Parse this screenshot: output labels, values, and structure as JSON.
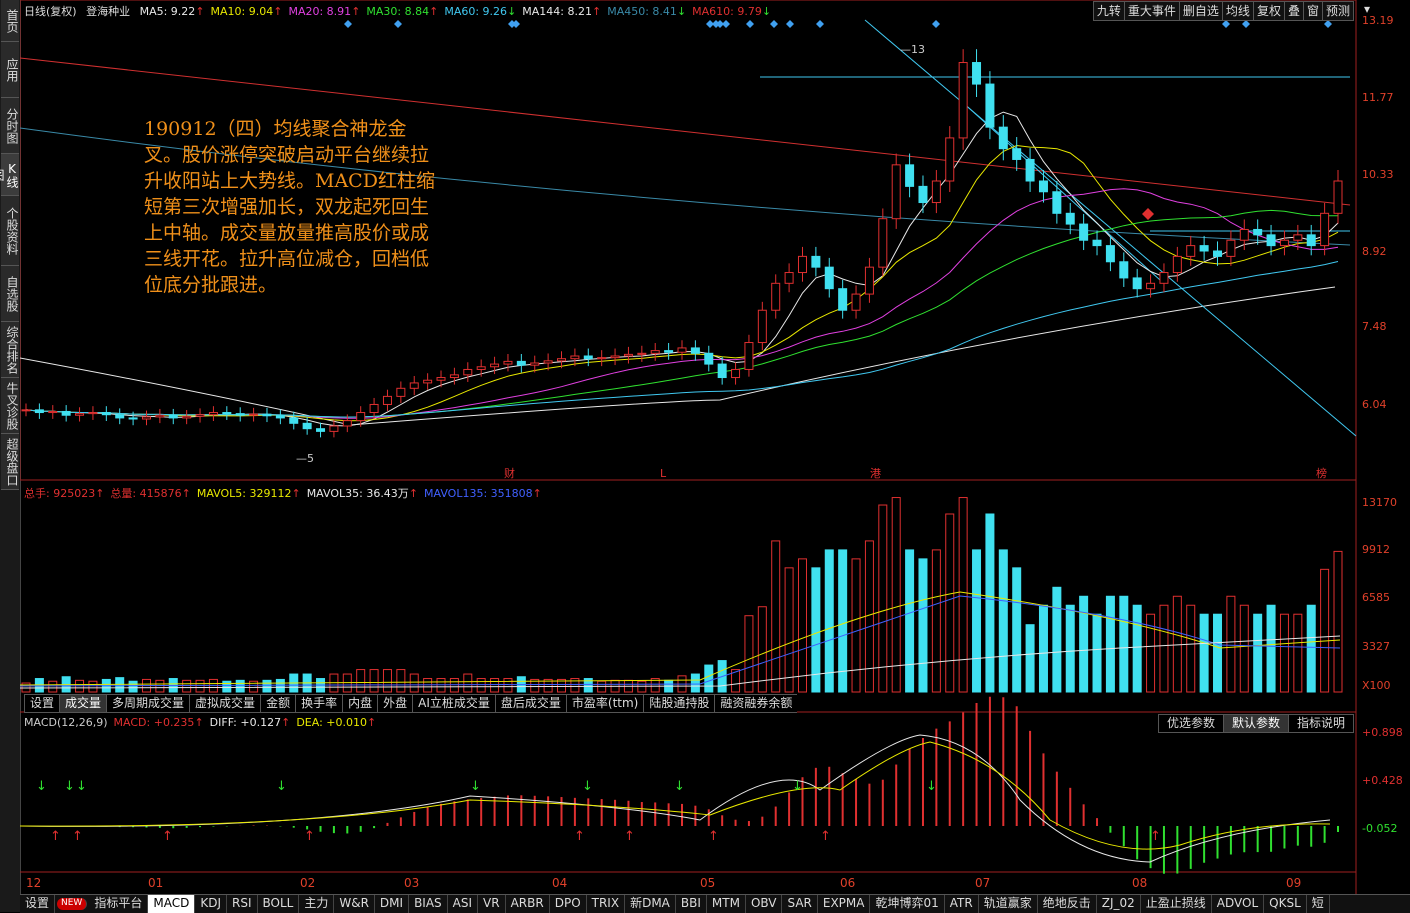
{
  "sidebar": {
    "tabs": [
      {
        "label": "首页",
        "active": false
      },
      {
        "label": "应用",
        "active": false
      },
      {
        "label": "分时图",
        "active": false
      },
      {
        "label": "K线图",
        "active": true
      },
      {
        "label": "个股资料",
        "active": false
      },
      {
        "label": "自选股",
        "active": false
      },
      {
        "label": "综合排名",
        "active": false
      },
      {
        "label": "牛叉诊股",
        "active": false
      },
      {
        "label": "超级盘口",
        "active": false
      }
    ]
  },
  "header": {
    "period": "日线(复权)",
    "stock": "登海种业",
    "ma": [
      {
        "label": "MA5: 9.22",
        "arrow": "↑",
        "color": "#e8e8e8"
      },
      {
        "label": "MA10: 9.04",
        "arrow": "↑",
        "color": "#e8e800"
      },
      {
        "label": "MA20: 8.91",
        "arrow": "↑",
        "color": "#e040e0"
      },
      {
        "label": "MA30: 8.84",
        "arrow": "↑",
        "color": "#30e030"
      },
      {
        "label": "MA60: 9.26",
        "arrow": "↓",
        "color": "#40c8f0"
      },
      {
        "label": "MA144: 8.21",
        "arrow": "↑",
        "color": "#e8e8e8"
      },
      {
        "label": "MA450: 8.41",
        "arrow": "↓",
        "color": "#3a8aa8"
      },
      {
        "label": "MA610: 9.79",
        "arrow": "↓",
        "color": "#e03030"
      }
    ],
    "toolbar": [
      "九转",
      "重大事件",
      "删自选",
      "均线",
      "复权",
      "叠",
      "窗",
      "预测"
    ]
  },
  "price_axis": [
    "13.19",
    "11.77",
    "10.33",
    "8.92",
    "7.48",
    "6.04"
  ],
  "annotation": "190912（四）均线聚合神龙金叉。股价涨停突破启动平台继续拉升收阳站上大势线。MACD红柱缩短第三次增强加长，双龙起死回生上中轴。成交量放量推高股价或成三线开花。拉升高位减仓，回档低位底分批跟进。",
  "markers": {
    "high": "13",
    "low": "5",
    "events": [
      {
        "label": "财",
        "color": "#e03030"
      },
      {
        "label": "L",
        "color": "#e03030"
      },
      {
        "label": "港",
        "color": "#e03030"
      },
      {
        "label": "榜",
        "color": "#e03030"
      }
    ]
  },
  "volume": {
    "legend": [
      {
        "label": "总手: 925023",
        "arrow": "↑",
        "color": "#e03030"
      },
      {
        "label": "总量: 415876",
        "arrow": "↑",
        "color": "#e03030"
      },
      {
        "label": "MAVOL5: 329112",
        "arrow": "↑",
        "color": "#e8e800"
      },
      {
        "label": "MAVOL35: 36.43万",
        "arrow": "↑",
        "color": "#e8e8e8"
      },
      {
        "label": "MAVOL135: 351808",
        "arrow": "↑",
        "color": "#4060ff"
      }
    ],
    "axis": [
      "13170",
      "9912",
      "6585",
      "3327",
      "X100"
    ],
    "tabs": [
      "设置",
      "成交量",
      "多周期成交量",
      "虚拟成交量",
      "金额",
      "换手率",
      "内盘",
      "外盘",
      "AI立桩成交量",
      "盘后成交量",
      "市盈率(ttm)",
      "陆股通持股",
      "融资融券余额"
    ],
    "active_tab": 1
  },
  "macd": {
    "legend": [
      {
        "label": "MACD(12,26,9)",
        "arrow": "",
        "color": "#ccc"
      },
      {
        "label": "MACD: +0.235",
        "arrow": "↑",
        "color": "#e03030"
      },
      {
        "label": "DIFF: +0.127",
        "arrow": "↑",
        "color": "#e8e8e8"
      },
      {
        "label": "DEA: +0.010",
        "arrow": "↑",
        "color": "#e8e800"
      }
    ],
    "axis": [
      "+0.898",
      "+0.428",
      "-0.052"
    ],
    "tabs": [
      "优选参数",
      "默认参数",
      "指标说明"
    ],
    "active_tab": 1
  },
  "xaxis": [
    "12",
    "01",
    "02",
    "03",
    "04",
    "05",
    "06",
    "07",
    "08",
    "09"
  ],
  "bottom_tabs": [
    "设置",
    "NEW",
    "指标平台",
    "MACD",
    "KDJ",
    "RSI",
    "BOLL",
    "主力",
    "W&R",
    "DMI",
    "BIAS",
    "ASI",
    "VR",
    "ARBR",
    "DPO",
    "TRIX",
    "新DMA",
    "BBI",
    "MTM",
    "OBV",
    "SAR",
    "EXPMA",
    "乾坤博弈01",
    "ATR",
    "轨道赢家",
    "绝地反击",
    "ZJ_02",
    "止盈止损线",
    "ADVOL",
    "QKSL",
    "短"
  ],
  "bottom_active": 3,
  "chart_data": {
    "type": "candlestick",
    "title": "登海种业",
    "ylim": [
      6.04,
      13.19
    ],
    "ohlc_close_sample": [
      5.95,
      5.9,
      5.92,
      5.85,
      5.88,
      5.9,
      5.86,
      5.8,
      5.78,
      5.82,
      5.85,
      5.8,
      5.83,
      5.86,
      5.9,
      5.88,
      5.85,
      5.87,
      5.84,
      5.8,
      5.7,
      5.6,
      5.55,
      5.65,
      5.75,
      5.9,
      6.05,
      6.2,
      6.35,
      6.45,
      6.5,
      6.55,
      6.6,
      6.7,
      6.75,
      6.8,
      6.85,
      6.78,
      6.82,
      6.86,
      6.9,
      6.95,
      6.9,
      6.92,
      6.95,
      6.98,
      7.0,
      7.05,
      7.02,
      7.1,
      7.0,
      6.8,
      6.55,
      6.7,
      7.2,
      7.8,
      8.3,
      8.5,
      8.8,
      8.6,
      8.2,
      7.8,
      8.1,
      8.6,
      9.5,
      10.5,
      10.1,
      9.8,
      10.2,
      11.0,
      12.4,
      12.0,
      11.2,
      10.8,
      10.6,
      10.2,
      10.0,
      9.6,
      9.4,
      9.1,
      9.0,
      8.7,
      8.4,
      8.2,
      8.3,
      8.5,
      8.8,
      9.0,
      8.9,
      8.8,
      9.1,
      9.3,
      9.2,
      9.0,
      9.1,
      9.2,
      9.0,
      9.6,
      10.2
    ]
  }
}
